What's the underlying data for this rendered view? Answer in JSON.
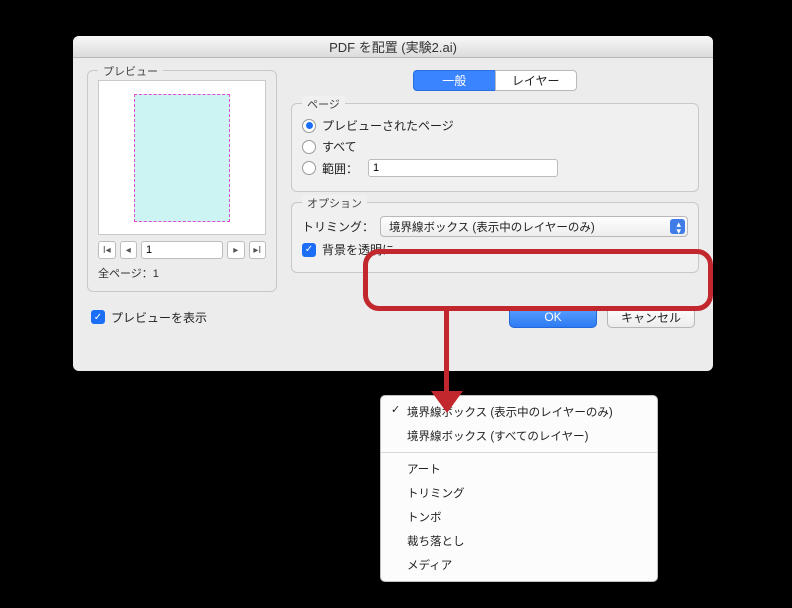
{
  "dialog": {
    "title": "PDF を配置 (実験2.ai)",
    "preview": {
      "legend": "プレビュー",
      "page_input_value": "1",
      "total_pages_label": "全ページ：1"
    },
    "tabs": {
      "general": "一般",
      "layers": "レイヤー"
    },
    "pages": {
      "legend": "ページ",
      "r1": "プレビューされたページ",
      "r2": "すべて",
      "r3": "範囲：",
      "range_value": "1"
    },
    "options": {
      "legend": "オプション",
      "trimming_label": "トリミング：",
      "trimming_select": "境界線ボックス (表示中のレイヤーのみ)",
      "transparent_bg": "背景を透明に"
    },
    "footer": {
      "show_preview": "プレビューを表示",
      "ok": "OK",
      "cancel": "キャンセル"
    }
  },
  "dropdown": {
    "items_a": [
      "境界線ボックス (表示中のレイヤーのみ)",
      "境界線ボックス (すべてのレイヤー)"
    ],
    "items_b": [
      "アート",
      "トリミング",
      "トンボ",
      "裁ち落とし",
      "メディア"
    ]
  }
}
